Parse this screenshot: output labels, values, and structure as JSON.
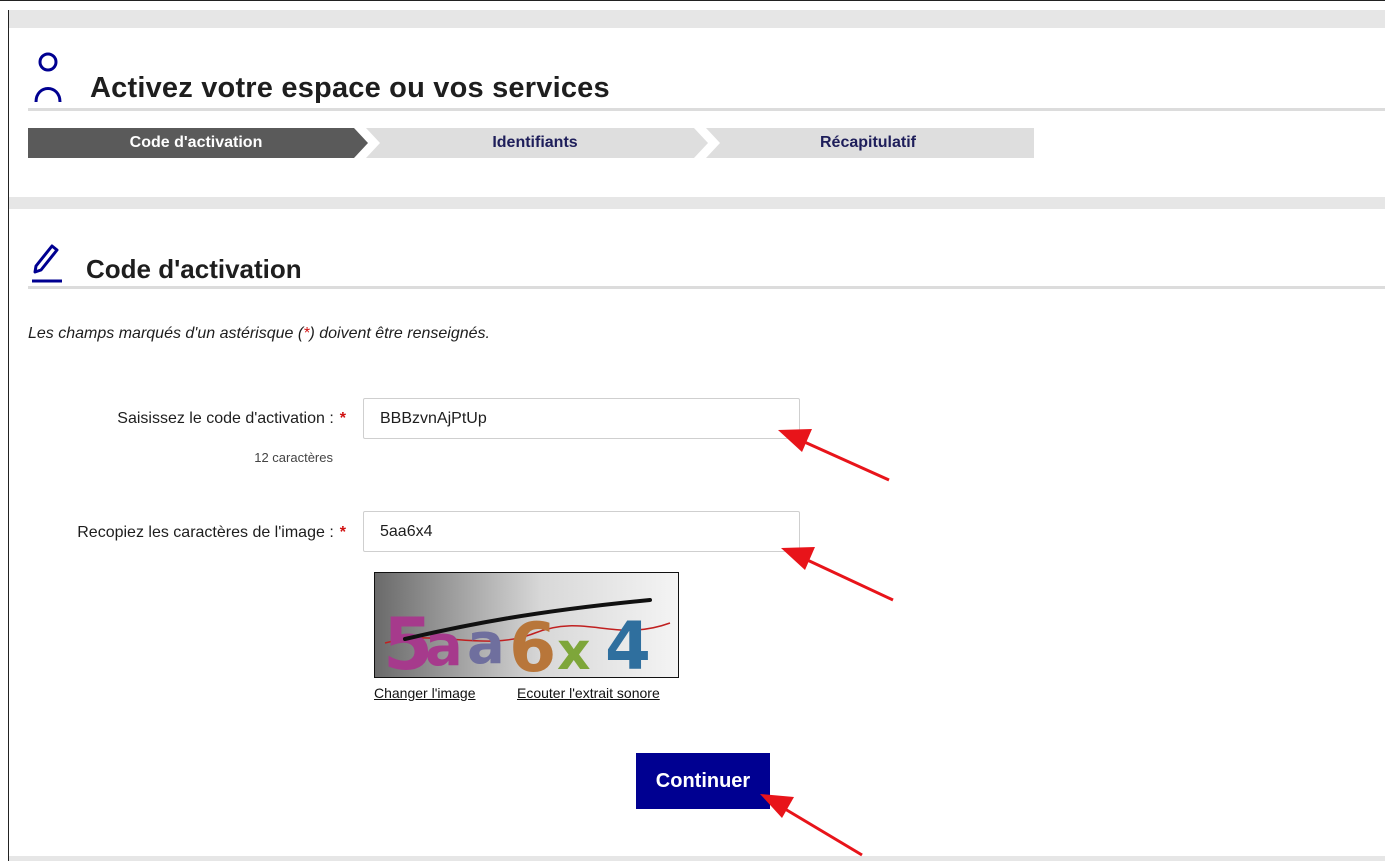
{
  "header": {
    "title": "Activez votre espace ou vos services",
    "icon": "user-icon"
  },
  "steps": [
    {
      "label": "Code d'activation",
      "active": true
    },
    {
      "label": "Identifiants",
      "active": false
    },
    {
      "label": "Récapitulatif",
      "active": false
    }
  ],
  "section": {
    "title": "Code d'activation",
    "icon": "pencil-icon"
  },
  "note": {
    "before": "Les champs marqués d'un astérisque (",
    "star": "*",
    "after": ") doivent être renseignés."
  },
  "form": {
    "activation_label": "Saisissez le code d'activation :",
    "activation_value": "BBBzvnAjPtUp",
    "activation_hint": "12 caractères",
    "captcha_label": "Recopiez les caractères de l'image :",
    "captcha_value": "5aa6x4",
    "required_mark": "*"
  },
  "captcha": {
    "chars": [
      "5",
      "a",
      "a",
      "6",
      "x",
      "4"
    ],
    "colors": [
      "#a63a8c",
      "#a63a8c",
      "#6f6f9e",
      "#b8763a",
      "#7ea63a",
      "#2f6f9e"
    ],
    "change_link": "Changer l'image",
    "audio_link": "Ecouter l'extrait sonore"
  },
  "actions": {
    "continue_label": "Continuer"
  },
  "colors": {
    "primary": "#000091",
    "required": "#d01010",
    "annotation_arrow": "#e8141a"
  }
}
